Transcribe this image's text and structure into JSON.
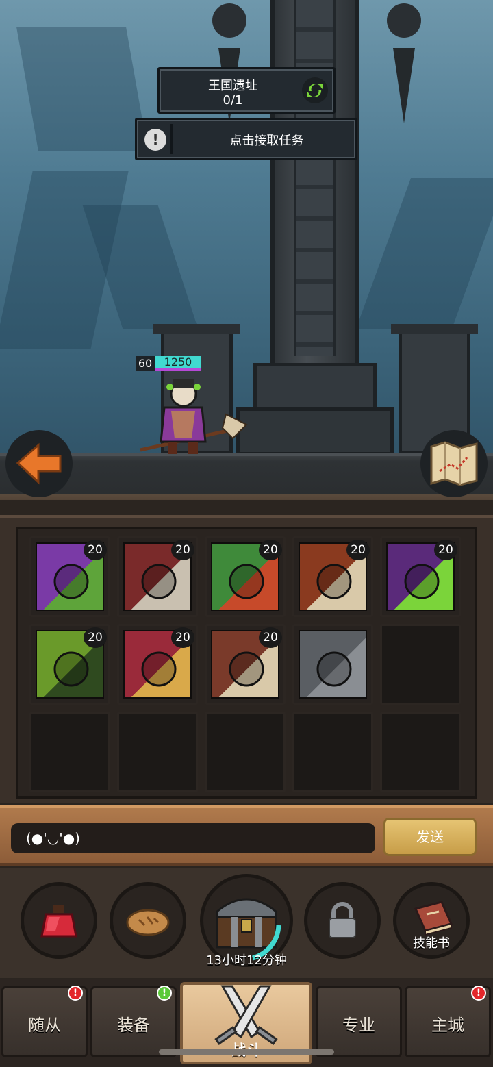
{
  "quest": {
    "name": "王国遗址",
    "progress": "0/1"
  },
  "task": {
    "label": "点击接取任务",
    "icon": "exclamation-icon"
  },
  "hero": {
    "level": "60",
    "hp": "1250"
  },
  "inventory": {
    "slots": [
      {
        "level": "20",
        "icon": "green-staff-icon",
        "colors": [
          "#7a3aa6",
          "#5ea43a"
        ]
      },
      {
        "level": "20",
        "icon": "red-helm-icon",
        "colors": [
          "#7a2a2a",
          "#c9c0b0"
        ]
      },
      {
        "level": "20",
        "icon": "goblin-face-icon",
        "colors": [
          "#3f8a3a",
          "#c74a2a"
        ]
      },
      {
        "level": "20",
        "icon": "bone-jaw-icon",
        "colors": [
          "#8a3a1f",
          "#d9c9a9"
        ]
      },
      {
        "level": "20",
        "icon": "purple-eye-icon",
        "colors": [
          "#5a2a7a",
          "#7bd43a"
        ]
      },
      {
        "level": "20",
        "icon": "green-mask-icon",
        "colors": [
          "#6a9a2a",
          "#2f4a1f"
        ]
      },
      {
        "level": "20",
        "icon": "red-crest-icon",
        "colors": [
          "#9a2a3a",
          "#d9a94a"
        ]
      },
      {
        "level": "20",
        "icon": "roaring-beast-icon",
        "colors": [
          "#7a3a2a",
          "#d9c9a9"
        ]
      },
      {
        "level": "",
        "icon": "locked-fist-icon",
        "colors": [
          "#5a5e63",
          "#8a8e93"
        ]
      }
    ]
  },
  "chat": {
    "input_value": "(●'◡'●)",
    "send_label": "发送"
  },
  "actions": {
    "potion_icon": "potion-icon",
    "bread_icon": "bread-icon",
    "chest_timer": "13小时12分钟",
    "lock_icon": "lock-icon",
    "skillbook_label": "技能书"
  },
  "nav": {
    "tabs": [
      {
        "label": "随从",
        "badge": "!",
        "badge_color": "red"
      },
      {
        "label": "装备",
        "badge": "!",
        "badge_color": "green"
      },
      {
        "label": "战斗",
        "badge": "",
        "badge_color": ""
      },
      {
        "label": "专业",
        "badge": "",
        "badge_color": ""
      },
      {
        "label": "主城",
        "badge": "!",
        "badge_color": "red"
      }
    ]
  }
}
